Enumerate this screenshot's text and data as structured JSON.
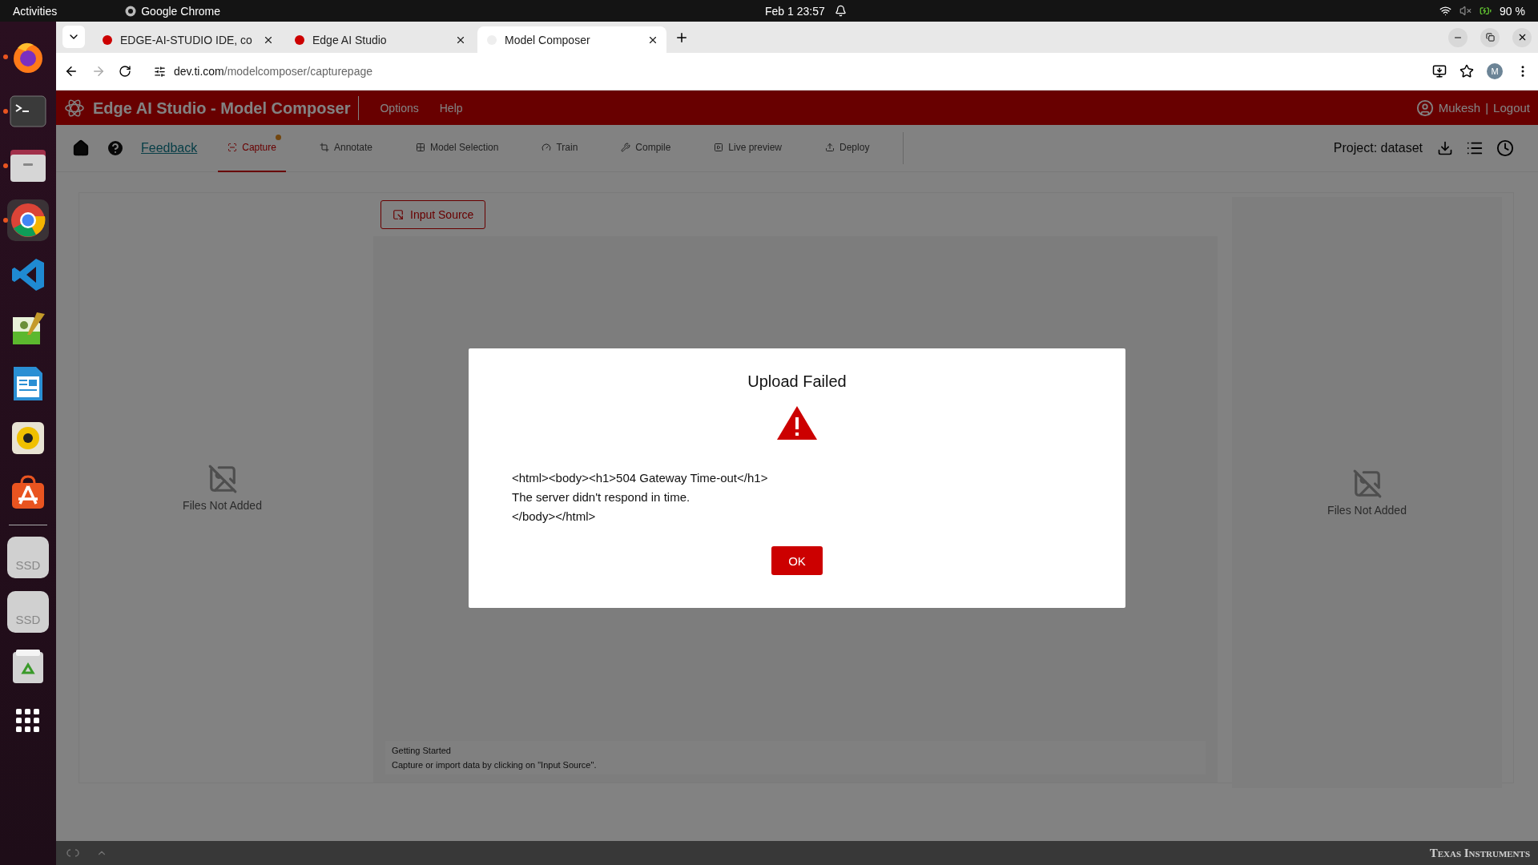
{
  "system_bar": {
    "activities": "Activities",
    "app": "Google Chrome",
    "clock": "Feb 1  23:57",
    "battery": "90 %"
  },
  "dock": [
    {
      "kind": "firefox",
      "running": true
    },
    {
      "kind": "terminal",
      "running": true
    },
    {
      "kind": "files",
      "running": true
    },
    {
      "kind": "chrome",
      "running": true
    },
    {
      "kind": "vscode",
      "running": false
    },
    {
      "kind": "editor",
      "running": false
    },
    {
      "kind": "writer",
      "running": false
    },
    {
      "kind": "speaker",
      "running": false
    },
    {
      "kind": "store",
      "running": false
    },
    {
      "kind": "separator"
    },
    {
      "kind": "drive",
      "label": "SSD",
      "running": false
    },
    {
      "kind": "drive",
      "label": "SSD",
      "running": false
    },
    {
      "kind": "trash",
      "running": false
    },
    {
      "kind": "grid",
      "running": false
    }
  ],
  "browser": {
    "tabs": [
      {
        "title": "EDGE-AI-STUDIO IDE, co",
        "selected": false
      },
      {
        "title": "Edge AI Studio",
        "selected": false
      },
      {
        "title": "Model Composer",
        "selected": true
      }
    ],
    "url_host": "dev.ti.com",
    "url_path": "/modelcomposer/capturepage",
    "profile": "M"
  },
  "app": {
    "title": "Edge AI Studio - Model Composer",
    "menu": [
      "Options",
      "Help"
    ],
    "user": "Mukesh",
    "separator": "|",
    "logout": "Logout",
    "feedback": "Feedback",
    "steps": [
      {
        "label": "Capture",
        "selected": true,
        "alert": true
      },
      {
        "label": "Annotate",
        "selected": false,
        "alert": false
      },
      {
        "label": "Model Selection",
        "selected": false,
        "alert": false
      },
      {
        "label": "Train",
        "selected": false,
        "alert": false
      },
      {
        "label": "Compile",
        "selected": false,
        "alert": false
      },
      {
        "label": "Live preview",
        "selected": false,
        "alert": false
      },
      {
        "label": "Deploy",
        "selected": false,
        "alert": false
      }
    ],
    "project": "Project: dataset",
    "input_source": "Input Source",
    "left_panel": {
      "empty": "Files Not Added"
    },
    "right_panel": {
      "empty": "Files Not Added"
    },
    "getting_started": {
      "title": "Getting Started",
      "text": "Capture or import data by clicking on \"Input Source\"."
    },
    "footer": {
      "brand": "Texas Instruments"
    }
  },
  "dialog": {
    "title": "Upload Failed",
    "lines": [
      "<html><body><h1>504 Gateway Time-out</h1>",
      "The server didn't respond in time.",
      "</body></html>"
    ],
    "button": "OK"
  }
}
